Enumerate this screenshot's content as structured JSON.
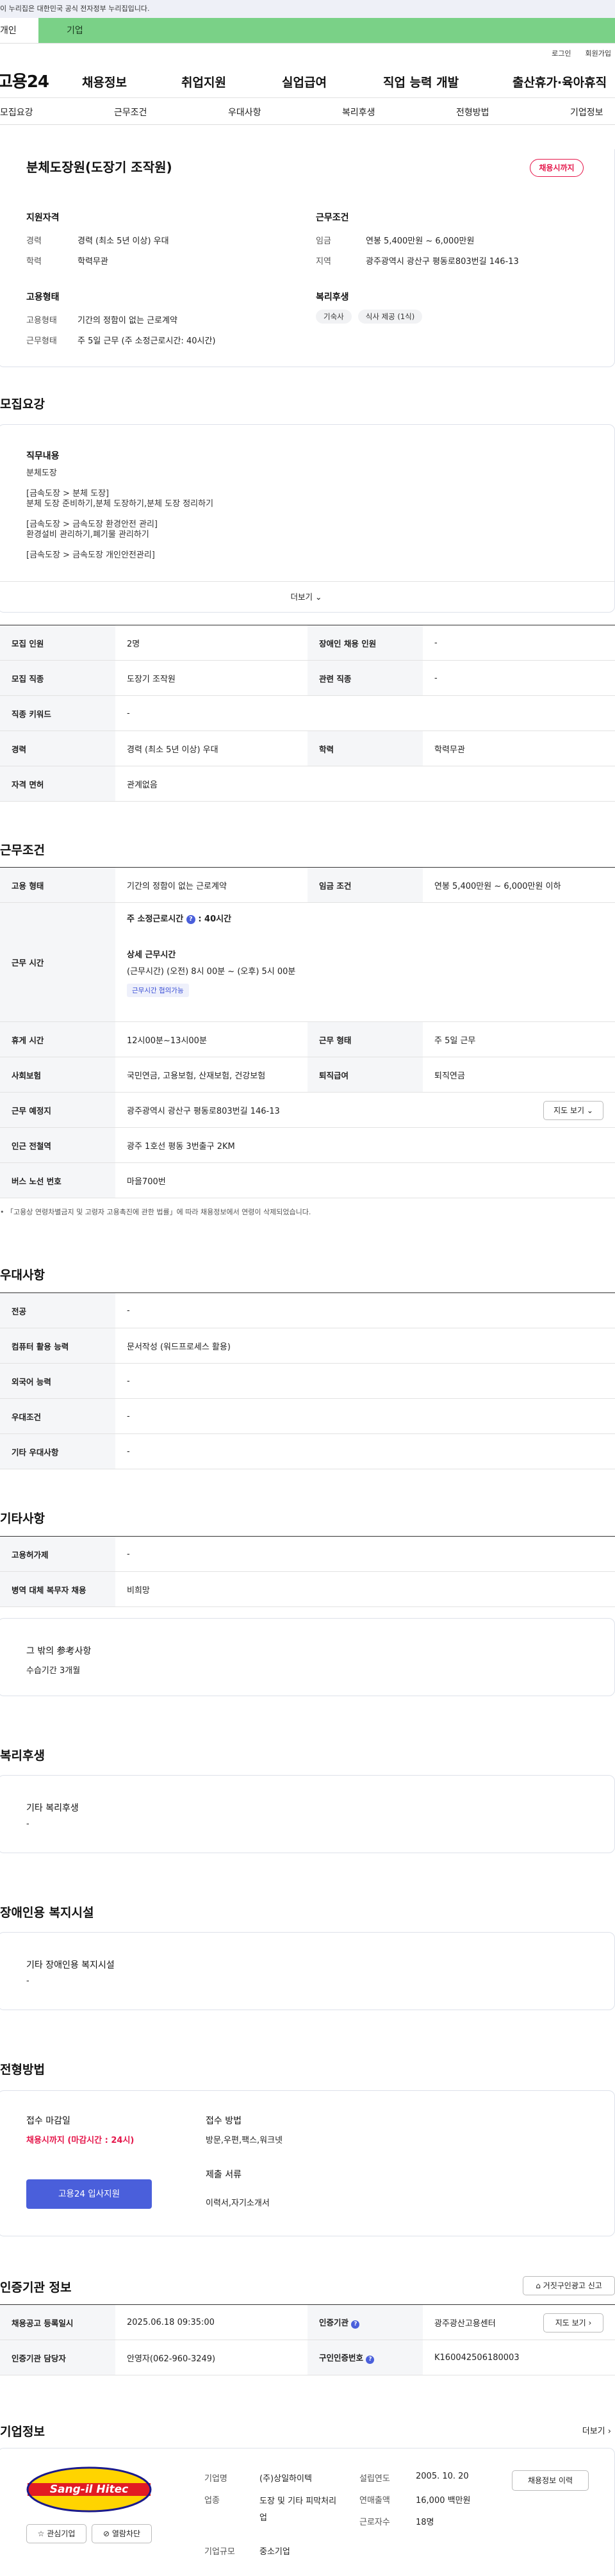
{
  "gov_bar": "이 누리집은 대한민국 공식 전자정부 누리집입니다.",
  "tabs": [
    "개인",
    "기업"
  ],
  "util_links": [
    "로그인",
    "회원가입"
  ],
  "logo": "고용24",
  "gnb": [
    "채용정보",
    "취업지원",
    "실업급여",
    "직업 능력 개발",
    "출산휴가·육아휴직"
  ],
  "lnb": [
    "모집요강",
    "근무조건",
    "우대사항",
    "복리후생",
    "전형방법",
    "기업정보"
  ],
  "summary": {
    "title": "분체도장원(도장기 조작원)",
    "badge": "채용시까지",
    "qual_head": "지원자격",
    "qual": [
      {
        "label": "경력",
        "value": "경력 (최소 5년 이상) 우대"
      },
      {
        "label": "학력",
        "value": "학력무관"
      }
    ],
    "cond_head": "근무조건",
    "cond": [
      {
        "label": "임금",
        "value": "연봉 5,400만원 ~ 6,000만원"
      },
      {
        "label": "지역",
        "value": "광주광역시 광산구 평동로803번길 146-13"
      }
    ],
    "emp_head": "고용형태",
    "emp": [
      {
        "label": "고용형태",
        "value": "기간의 정함이 없는 근로계약"
      },
      {
        "label": "근무형태",
        "value": "주 5일 근무 (주 소정근로시간: 40시간)"
      }
    ],
    "welfare_head": "복리후생",
    "welfare_pills": [
      "기숙사",
      "식사 제공 (1식)"
    ]
  },
  "recruit": {
    "title": "모집요강",
    "duty_head": "직무내용",
    "duty_lines": [
      "분체도장",
      "",
      "[금속도장 > 분체 도장]",
      "분체 도장 준비하기,분체 도장하기,분체 도장 정리하기",
      "",
      "[금속도장 > 금속도장 환경안전 관리]",
      "환경설비 관리하기,폐기물 관리하기",
      "",
      "[금속도장 > 금속도장 개인안전관리]"
    ],
    "more": "더보기",
    "rows": [
      {
        "k1": "모집 인원",
        "v1": "2명",
        "k2": "장애인 채용 인원",
        "v2": "-"
      },
      {
        "k1": "모집 직종",
        "v1": "도장기 조작원",
        "k2": "관련 직종",
        "v2": "-"
      },
      {
        "k1": "직종 키워드",
        "v1": "-"
      },
      {
        "k1": "경력",
        "v1": "경력 (최소 5년 이상) 우대",
        "k2": "학력",
        "v2": "학력무관"
      },
      {
        "k1": "자격 면허",
        "v1": "관계없음"
      }
    ]
  },
  "work": {
    "title": "근무조건",
    "emp_type_k": "고용 형태",
    "emp_type_v": "기간의 정함이 없는 근로계약",
    "wage_k": "임금 조건",
    "wage_v": "연봉 5,400만원 ~ 6,000만원 이하",
    "hours_k": "근무 시간",
    "hours_main": "주 소정근로시간",
    "hours_main_v": ": 40시간",
    "hours_detail_head": "상세 근무시간",
    "hours_detail": "(근무시간) (오전) 8시 00분 ~ (오후) 5시 00분",
    "flex_tag": "근무시간 협의가능",
    "rest_k": "휴게 시간",
    "rest_v": "12시00분~13시00분",
    "shape_k": "근무 형태",
    "shape_v": "주 5일 근무",
    "ins_k": "사회보험",
    "ins_v": "국민연금, 고용보험, 산재보험, 건강보험",
    "ret_k": "퇴직급여",
    "ret_v": "퇴직연금",
    "loc_k": "근무 예정지",
    "loc_v": "광주광역시 광산구 평동로803번길 146-13",
    "map_btn": "지도 보기",
    "sub_k": "인근 전철역",
    "sub_v": "광주 1호선 평동 3번출구 2KM",
    "bus_k": "버스 노선 번호",
    "bus_v": "마을700번",
    "note": "「고용상 연령차별금지 및 고령자 고용촉진에 관한 법률」에 따라 채용정보에서 연령이 삭제되었습니다."
  },
  "pref": {
    "title": "우대사항",
    "rows": [
      {
        "k": "전공",
        "v": "-"
      },
      {
        "k": "컴퓨터 활용 능력",
        "v": "문서작성 (워드프로세스 활용)"
      },
      {
        "k": "외국어 능력",
        "v": "-"
      },
      {
        "k": "우대조건",
        "v": "-"
      },
      {
        "k": "기타 우대사항",
        "v": "-"
      }
    ]
  },
  "etc": {
    "title": "기타사항",
    "rows": [
      {
        "k": "고용허가제",
        "v": "-"
      },
      {
        "k": "병역 대체 복무자 채용",
        "v": "비희망"
      }
    ],
    "box_head": "그 밖의 参考사항",
    "box_val": "수습기간 3개월"
  },
  "welfare": {
    "title": "복리후생",
    "head": "기타 복리후생",
    "val": "-"
  },
  "disabled": {
    "title": "장애인용 복지시설",
    "head": "기타 장애인용 복지시설",
    "val": "-"
  },
  "process": {
    "title": "전형방법",
    "deadline_head": "접수 마감일",
    "deadline_val": "채용시까지 (마감시간 : 24시)",
    "apply_btn": "고용24 입사지원",
    "method_head": "접수 방법",
    "method_val": "방문,우편,팩스,워크넷",
    "docs_head": "제출 서류",
    "docs_val": "이력서,자기소개서"
  },
  "agency": {
    "title": "인증기관 정보",
    "report_btn": "거짓구인광고 신고",
    "rows": [
      {
        "k1": "채용공고 등록일시",
        "v1": "2025.06.18 09:35:00",
        "k2": "인증기관",
        "v2": "광주광산고용센터"
      },
      {
        "k1": "인증기관 담당자",
        "v1": "안영자(062-960-3249)",
        "k2": "구인인증번호",
        "v2": "K160042506180003"
      }
    ],
    "map_btn": "지도 보기"
  },
  "company": {
    "title": "기업정보",
    "more": "더보기",
    "logo_text": "Sang-il Hitec",
    "fav_btn": "관심기업",
    "block_btn": "열람차단",
    "name_k": "기업명",
    "name_v": "(주)상일하이텍",
    "ind_k": "업종",
    "ind_v": "도장 및 기타 피막처리업",
    "size_k": "기업규모",
    "size_v": "중소기업",
    "est_k": "설립연도",
    "est_v": "2005. 10. 20",
    "sales_k": "연매출액",
    "sales_v": "16,000 백만원",
    "emp_k": "근로자수",
    "emp_v": "18명",
    "history_btn": "채용정보 이력"
  },
  "colors": {
    "green_tab": "#7ad187",
    "accent_red": "#e5164a",
    "apply_blue": "#4a5fdb"
  }
}
